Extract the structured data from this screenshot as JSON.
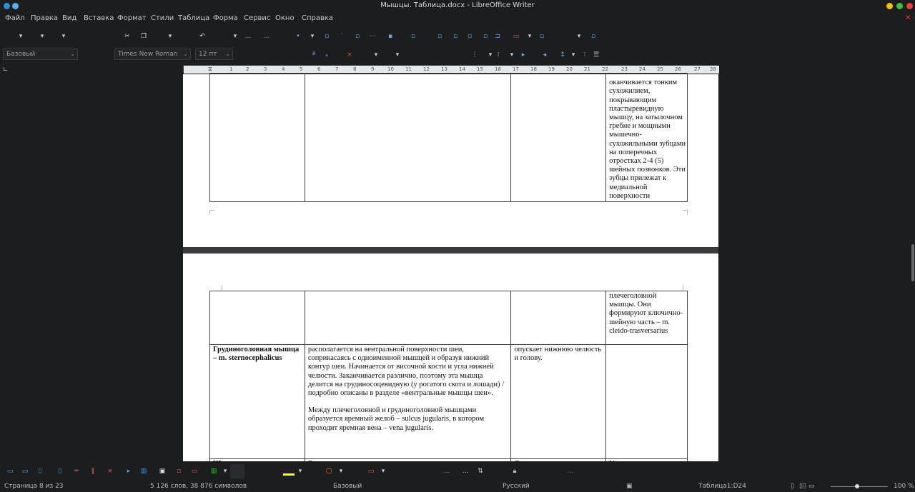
{
  "window": {
    "title": "Мышцы. Таблица.docx - LibreOffice Writer"
  },
  "menu": [
    "Файл",
    "Правка",
    "Вид",
    "Вставка",
    "Формат",
    "Стили",
    "Таблица",
    "Форма",
    "Сервис",
    "Окно",
    "Справка"
  ],
  "formatting": {
    "paragraph_style": "Базовый",
    "font_name": "Times New Roman",
    "font_size": "12 пт"
  },
  "ruler": {
    "numbers": [
      "1",
      "2",
      "3",
      "4",
      "5",
      "6",
      "7",
      "8",
      "9",
      "10",
      "11",
      "12",
      "13",
      "14",
      "15",
      "16",
      "17",
      "18",
      "19",
      "20",
      "21",
      "22",
      "23",
      "24",
      "25",
      "26",
      "27",
      "28"
    ]
  },
  "document": {
    "page1_table": {
      "col4_text": "оканчивается тонким сухожилием, покрывающим пластыревидную мышцу, на затылочном гребне и мощными мышечно-сухожильными зубцами на поперечных отростках 2-4 (5) шейных позвонков. Эти зубцы прилежат к медиальной поверхности"
    },
    "page2_table": {
      "row1_col4": "плечеголовной мышцы. Они формируют ключично-шейную часть – m. cleido-trasversarius",
      "row2_col1": "Грудиноголовная мышца – m. sternocephalicus",
      "row2_col2_p1": "располагается на вентральной поверхности шеи, соприкасаясь с одноименной мышцей и образуя нижний контур шеи. Начинается от височной кости и угла нижней челюсти. Заканчивается различно, поэтому эта мышца делится на грудиносоцевидную (у рогатого скота и лошади) /подробно описаны в разделе «вентральные мышцы шеи».",
      "row2_col2_p2": "Между плечеголовной и грудиноголовной мышцами образуется яремный желоб – sulcus jugularis, в котором проходит яремная вена – vena jugularis.",
      "row2_col3": "опускает нижнюю челюсть и голову.",
      "row3_col1": "Ш",
      "row3_col2": "В",
      "row3_col3": "Я",
      "row3_col4": "У"
    }
  },
  "status": {
    "page": "Страница 8 из 23",
    "words": "5 126 слов, 38 876 символов",
    "page_style": "Базовый",
    "language": "Русский",
    "cell": "Таблица1:D24",
    "zoom": "100 %"
  },
  "colors": {
    "font_color": "#c9211e",
    "highlight_color": "#ffff00",
    "accent": "#4f9ad8"
  }
}
